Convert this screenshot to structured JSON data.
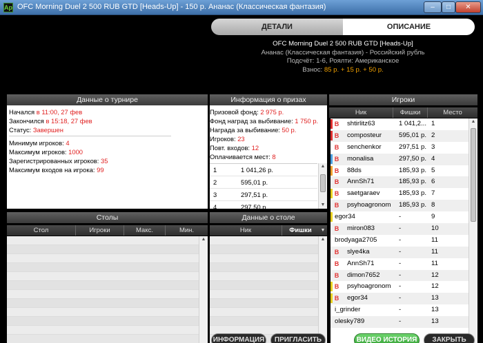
{
  "window": {
    "title": "OFC Morning Duel 2 500 RUB GTD [Heads-Up] - 150 р. Ананас (Классическая фантазия)",
    "app_icon": "Ap",
    "minimize": "–",
    "maximize": "□",
    "close": "✕"
  },
  "tabs": {
    "details": "ДЕТАЛИ",
    "description": "ОПИСАНИЕ"
  },
  "header": {
    "tournament": "OFC Morning Duel 2 500 RUB GTD [Heads-Up]",
    "game": "Ананас (Классическая фантазия) - Российский рубль",
    "counting": "Подсчёт: 1-6, Роялти: Американское",
    "fee_label": "Взнос:",
    "fee_value": "85 р. + 15 р. + 50 р."
  },
  "tournament_info": {
    "title": "Данные о турнире",
    "started_label": "Начался",
    "started_value": "в 11:00, 27 фев",
    "ended_label": "Закончился",
    "ended_value": "в 15:18, 27 фев",
    "status_label": "Статус:",
    "status_value": "Завершен",
    "min_players_label": "Минимум игроков:",
    "min_players_value": "4",
    "max_players_label": "Максимум игроков:",
    "max_players_value": "1000",
    "registered_label": "Зарегистрированных игроков:",
    "registered_value": "35",
    "max_entries_label": "Максимум входов на игрока:",
    "max_entries_value": "99"
  },
  "prize_info": {
    "title": "Информация о призах",
    "pool_label": "Призовой фонд:",
    "pool_value": "2 975 р.",
    "bounty_fund_label": "Фонд наград за выбивание:",
    "bounty_fund_value": "1 750 р.",
    "bounty_label": "Награда за выбивание:",
    "bounty_value": "50 р.",
    "players_label": "Игроков:",
    "players_value": "23",
    "reentries_label": "Повт. входов:",
    "reentries_value": "12",
    "paid_label": "Оплачивается мест:",
    "paid_value": "8",
    "payouts": [
      {
        "place": "1",
        "amount": "1 041,26 р."
      },
      {
        "place": "2",
        "amount": "595,01 р."
      },
      {
        "place": "3",
        "amount": "297,51 р."
      },
      {
        "place": "4",
        "amount": "297,50 р."
      }
    ]
  },
  "tables": {
    "title": "Столы",
    "columns": [
      "Стол",
      "Игроки",
      "Макс.",
      "Мин."
    ]
  },
  "table_data": {
    "title": "Данные о столе",
    "columns": [
      "Ник",
      "Фишки"
    ],
    "sort_arrow": "▼"
  },
  "players": {
    "title": "Игроки",
    "columns": [
      "Ник",
      "Фишки",
      "Место"
    ],
    "badge": "B",
    "rows": [
      {
        "nick": "shtirlitz63",
        "chips": "1 041,2...",
        "place": "1",
        "badge": true,
        "mark": "#e03030"
      },
      {
        "nick": "composteur",
        "chips": "595,01 р.",
        "place": "2",
        "badge": true,
        "mark": "#e03030"
      },
      {
        "nick": "senchenkor",
        "chips": "297,51 р.",
        "place": "3",
        "badge": true,
        "mark": ""
      },
      {
        "nick": "monalisa",
        "chips": "297,50 р.",
        "place": "4",
        "badge": true,
        "mark": "#4aa0e0"
      },
      {
        "nick": "88ds",
        "chips": "185,93 р.",
        "place": "5",
        "badge": true,
        "mark": "#f0a030"
      },
      {
        "nick": "AnnSh71",
        "chips": "185,93 р.",
        "place": "6",
        "badge": true,
        "mark": ""
      },
      {
        "nick": "saetgaraev",
        "chips": "185,93 р.",
        "place": "7",
        "badge": true,
        "mark": "#e8d020"
      },
      {
        "nick": "psyhoagronom",
        "chips": "185,93 р.",
        "place": "8",
        "badge": true,
        "mark": ""
      },
      {
        "nick": "egor34",
        "chips": "-",
        "place": "9",
        "badge": false,
        "mark": "#e8d020"
      },
      {
        "nick": "miron083",
        "chips": "-",
        "place": "10",
        "badge": true,
        "mark": ""
      },
      {
        "nick": "brodyaga2705",
        "chips": "-",
        "place": "11",
        "badge": false,
        "mark": ""
      },
      {
        "nick": "slye4ka",
        "chips": "-",
        "place": "11",
        "badge": true,
        "mark": ""
      },
      {
        "nick": "AnnSh71",
        "chips": "-",
        "place": "11",
        "badge": true,
        "mark": ""
      },
      {
        "nick": "dimon7652",
        "chips": "-",
        "place": "12",
        "badge": true,
        "mark": ""
      },
      {
        "nick": "psyhoagronom",
        "chips": "-",
        "place": "12",
        "badge": true,
        "mark": "#e8d020"
      },
      {
        "nick": "egor34",
        "chips": "-",
        "place": "13",
        "badge": true,
        "mark": "#e8d020"
      },
      {
        "nick": "i_grinder",
        "chips": "-",
        "place": "13",
        "badge": false,
        "mark": ""
      },
      {
        "nick": "olesky789",
        "chips": "-",
        "place": "13",
        "badge": false,
        "mark": ""
      }
    ]
  },
  "buttons": {
    "info": "ИНФОРМАЦИЯ",
    "invite": "ПРИГЛАСИТЬ",
    "video": "ВИДЕО ИСТОРИЯ",
    "close": "ЗАКРЫТЬ"
  }
}
